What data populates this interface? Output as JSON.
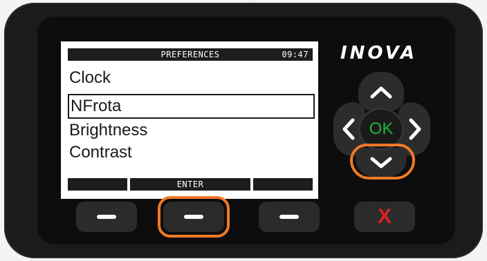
{
  "device": {
    "brand": "INOVA",
    "screen": {
      "header_title": "PREFERENCES",
      "header_time": "09:47",
      "menu_items": [
        "Clock",
        "NFrota",
        "Brightness",
        "Contrast"
      ],
      "selected_index": 1,
      "softkey_labels": [
        "",
        "ENTER",
        ""
      ]
    },
    "ok_label": "OK",
    "cancel_label": "X"
  },
  "colors": {
    "highlight": "#f07a26",
    "ok_text": "#1fb53f",
    "cancel_text": "#e02020"
  },
  "icons": {
    "up": "chevron-up-icon",
    "down": "chevron-down-icon",
    "left": "chevron-left-icon",
    "right": "chevron-right-icon"
  }
}
